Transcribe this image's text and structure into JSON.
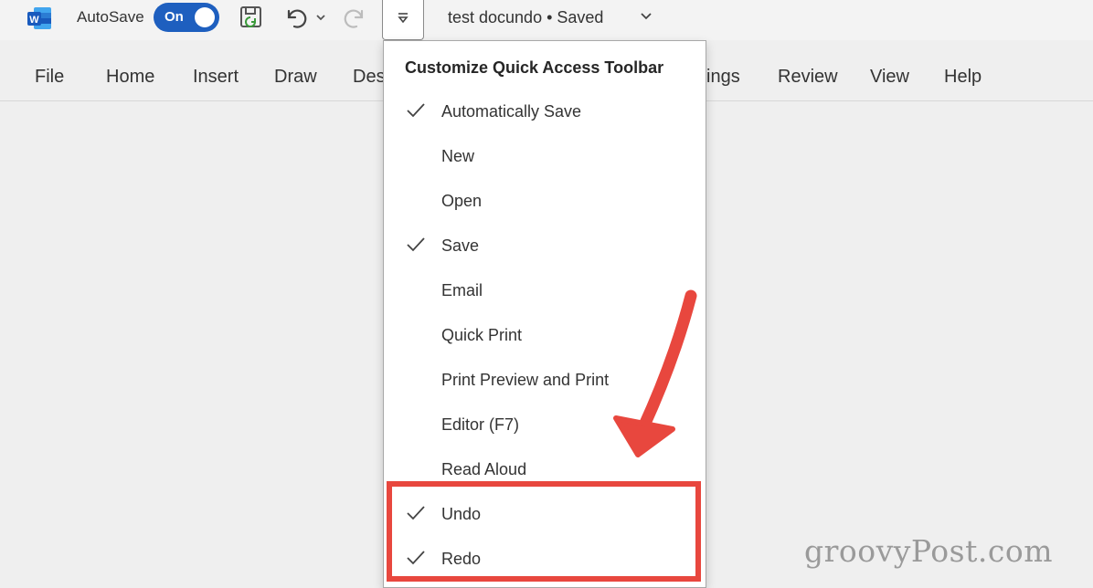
{
  "titlebar": {
    "autosave_label": "AutoSave",
    "autosave_state": "On",
    "document_title": "test docundo • Saved",
    "icons": [
      "word-app-icon",
      "save-icon",
      "undo-icon",
      "undo-dropdown-icon",
      "redo-icon",
      "customize-dropdown-icon",
      "chevron-down-icon"
    ]
  },
  "ribbon": {
    "tabs": [
      "File",
      "Home",
      "Insert",
      "Draw",
      "Des",
      "ings",
      "Review",
      "View",
      "Help"
    ]
  },
  "menu": {
    "header": "Customize Quick Access Toolbar",
    "items": [
      {
        "label": "Automatically Save",
        "checked": true
      },
      {
        "label": "New",
        "checked": false
      },
      {
        "label": "Open",
        "checked": false
      },
      {
        "label": "Save",
        "checked": true
      },
      {
        "label": "Email",
        "checked": false
      },
      {
        "label": "Quick Print",
        "checked": false
      },
      {
        "label": "Print Preview and Print",
        "checked": false
      },
      {
        "label": "Editor (F7)",
        "checked": false
      },
      {
        "label": "Read Aloud",
        "checked": false
      },
      {
        "label": "Undo",
        "checked": true
      },
      {
        "label": "Redo",
        "checked": true
      }
    ]
  },
  "annotation": {
    "highlight_color": "#e8473e"
  },
  "watermark": "groovyPost.com",
  "colors": {
    "accent": "#1e5fbf",
    "word_blue": "#185abd"
  }
}
